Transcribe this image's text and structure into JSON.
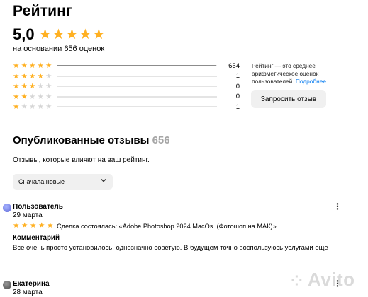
{
  "header": {
    "title": "Рейтинг",
    "score": "5,0",
    "score_stars": 5,
    "based_on": "на основании 656 оценок"
  },
  "distribution": [
    {
      "stars": 5,
      "count": "654",
      "fraction": 0.997
    },
    {
      "stars": 4,
      "count": "1",
      "fraction": 0.0015
    },
    {
      "stars": 3,
      "count": "0",
      "fraction": 0
    },
    {
      "stars": 2,
      "count": "0",
      "fraction": 0
    },
    {
      "stars": 1,
      "count": "1",
      "fraction": 0.0015
    }
  ],
  "rating_note": {
    "text": "Рейтинг — это среднее арифметическое оценок пользователей.",
    "link": "Подробнее"
  },
  "request_button": "Запросить отзыв",
  "reviews_section": {
    "title": "Опубликованные отзывы",
    "count": "656",
    "subtitle": "Отзывы, которые влияют на ваш рейтинг.",
    "sort_value": "Сначала новые"
  },
  "reviews": [
    {
      "name": "Пользователь",
      "date": "29 марта",
      "stars": 5,
      "deal": "Сделка состоялась: «Adobe Photoshop 2024 MacOs. (Фотошоп на МАК)»",
      "comment_label": "Комментарий",
      "comment": "Все очень просто установилось, однозначно советую. В будущем точно воспользуюсь услугами еще"
    },
    {
      "name": "Екатерина",
      "date": "28 марта"
    }
  ],
  "watermark": "Avito",
  "colors": {
    "star": "#ffb021",
    "star_empty": "#d6d6d6",
    "link": "#0a7df0",
    "muted_count": "#a6a6a6"
  },
  "icons": {
    "star": "star-icon",
    "chevron": "chevron-down-icon",
    "menu": "more-vertical-icon"
  }
}
